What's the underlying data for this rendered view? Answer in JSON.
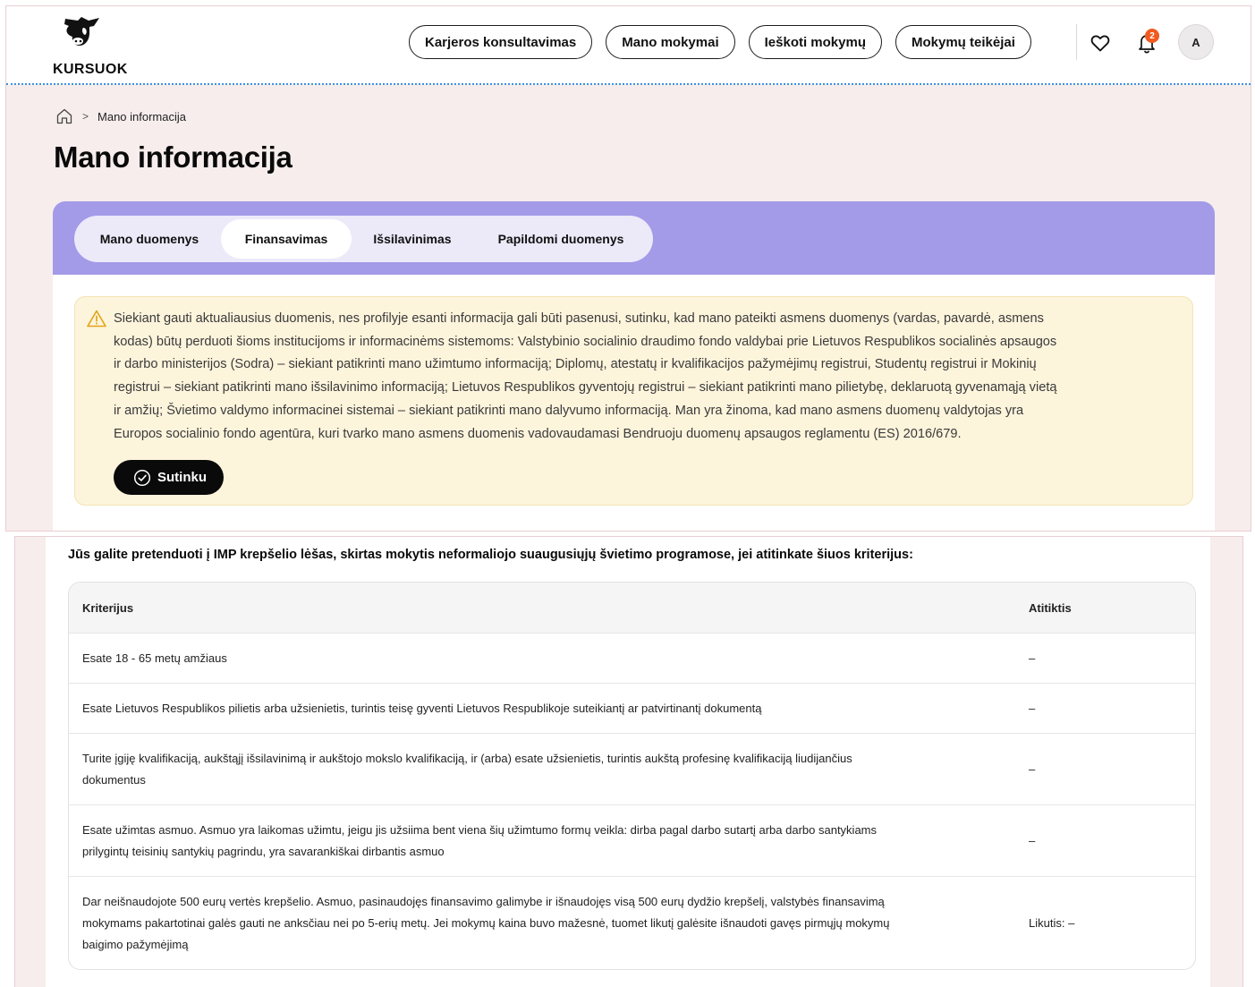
{
  "header": {
    "logo_text": "KURSUOK",
    "nav": [
      {
        "label": "Karjeros konsultavimas"
      },
      {
        "label": "Mano mokymai"
      },
      {
        "label": "Ieškoti mokymų"
      },
      {
        "label": "Mokymų teikėjai"
      }
    ],
    "notifications_count": "2",
    "avatar_initial": "A"
  },
  "breadcrumb": {
    "current": "Mano informacija",
    "separator": ">"
  },
  "page_title": "Mano informacija",
  "tabs": [
    {
      "label": "Mano duomenys",
      "active": false
    },
    {
      "label": "Finansavimas",
      "active": true
    },
    {
      "label": "Išsilavinimas",
      "active": false
    },
    {
      "label": "Papildomi duomenys",
      "active": false
    }
  ],
  "consent": {
    "lines": [
      "Siekiant gauti aktualiausius duomenis, nes profilyje esanti informacija gali būti pasenusi, sutinku, kad mano pateikti asmens duomenys (vardas, pavardė, asmens",
      "kodas) būtų perduoti šioms institucijoms ir informacinėms sistemoms: Valstybinio socialinio draudimo fondo valdybai prie Lietuvos Respublikos socialinės apsaugos",
      "ir darbo ministerijos (Sodra) – siekiant patikrinti mano užimtumo informaciją; Diplomų, atestatų ir kvalifikacijos pažymėjimų registrui, Studentų registrui ir Mokinių",
      "registrui – siekiant patikrinti mano išsilavinimo informaciją; Lietuvos Respublikos gyventojų registrui – siekiant patikrinti mano pilietybę, deklaruotą gyvenamąją vietą",
      "ir amžių; Švietimo valdymo informacinei sistemai – siekiant patikrinti mano dalyvumo informaciją. Man yra žinoma, kad mano asmens duomenų valdytojas yra",
      "Europos socialinio fondo agentūra, kuri tvarko mano asmens duomenis vadovaudamasi Bendruoju duomenų apsaugos reglamentu (ES) 2016/679."
    ],
    "button_label": "Sutinku"
  },
  "criteria": {
    "title": "Jūs galite pretenduoti į IMP krepšelio lėšas, skirtas mokytis neformaliojo suaugusiųjų švietimo programose, jei atitinkate šiuos kriterijus:",
    "headers": {
      "criterion": "Kriterijus",
      "match": "Atitiktis"
    },
    "rows": [
      {
        "lines": [
          "Esate 18 - 65 metų amžiaus"
        ],
        "match": "–"
      },
      {
        "lines": [
          "Esate Lietuvos Respublikos pilietis arba užsienietis, turintis teisę gyventi Lietuvos Respublikoje suteikiantį ar patvirtinantį dokumentą"
        ],
        "match": "–"
      },
      {
        "lines": [
          "Turite įgiję kvalifikaciją, aukštąjį išsilavinimą ir aukštojo mokslo kvalifikaciją, ir (arba) esate užsienietis, turintis aukštą profesinę kvalifikaciją liudijančius",
          "dokumentus"
        ],
        "match": "–"
      },
      {
        "lines": [
          "Esate užimtas asmuo. Asmuo yra laikomas užimtu, jeigu jis užsiima bent viena šių užimtumo formų veikla: dirba pagal darbo sutartį arba darbo santykiams",
          "prilygintų teisinių santykių pagrindu, yra savarankiškai dirbantis asmuo"
        ],
        "match": "–"
      },
      {
        "lines": [
          "Dar neišnaudojote 500 eurų vertės krepšelio. Asmuo, pasinaudojęs finansavimo galimybe ir išnaudojęs visą 500 eurų dydžio krepšelį, valstybės finansavimą",
          "mokymams pakartotinai galės gauti ne anksčiau nei po 5-erių metų. Jei mokymų kaina buvo mažesnė, tuomet likutį galėsite išnaudoti gavęs pirmųjų mokymų",
          "baigimo pažymėjimą"
        ],
        "match": "Likutis: –"
      }
    ]
  }
}
